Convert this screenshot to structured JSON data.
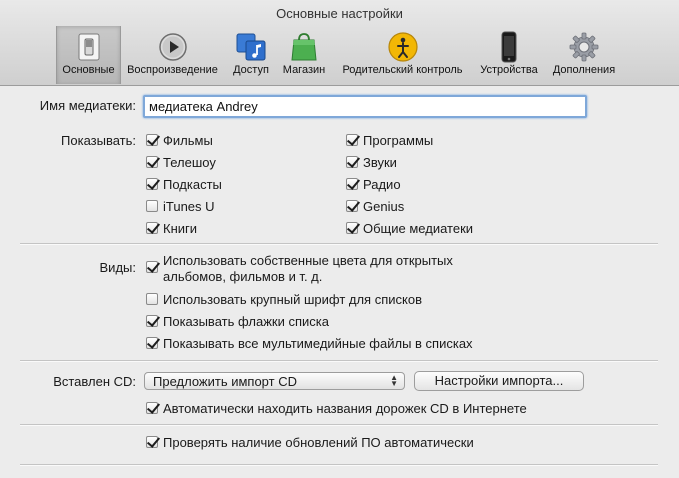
{
  "window": {
    "title": "Основные настройки"
  },
  "toolbar": {
    "tabs": [
      {
        "label": "Основные",
        "icon": "switch-icon"
      },
      {
        "label": "Воспроизведение",
        "icon": "play-icon"
      },
      {
        "label": "Доступ",
        "icon": "music-share-icon"
      },
      {
        "label": "Магазин",
        "icon": "store-bag-icon"
      },
      {
        "label": "Родительский контроль",
        "icon": "parental-control-icon"
      },
      {
        "label": "Устройства",
        "icon": "iphone-icon"
      },
      {
        "label": "Дополнения",
        "icon": "gear-icon"
      }
    ]
  },
  "library": {
    "label": "Имя медиатеки:",
    "value": "медиатека Andrey"
  },
  "show": {
    "label": "Показывать:",
    "left": [
      {
        "label": "Фильмы",
        "checked": true
      },
      {
        "label": "Телешоу",
        "checked": true
      },
      {
        "label": "Подкасты",
        "checked": true
      },
      {
        "label": "iTunes U",
        "checked": false
      },
      {
        "label": "Книги",
        "checked": true
      }
    ],
    "right": [
      {
        "label": "Программы",
        "checked": true
      },
      {
        "label": "Звуки",
        "checked": true
      },
      {
        "label": "Радио",
        "checked": true
      },
      {
        "label": "Genius",
        "checked": true
      },
      {
        "label": "Общие медиатеки",
        "checked": true
      }
    ]
  },
  "views": {
    "label": "Виды:",
    "items": [
      {
        "line1": "Использовать собственные цвета для открытых",
        "line2": "альбомов, фильмов и т. д.",
        "checked": true
      },
      {
        "line1": "Использовать крупный шрифт для списков",
        "checked": false
      },
      {
        "line1": "Показывать флажки списка",
        "checked": true
      },
      {
        "line1": "Показывать все мультимедийные файлы в списках",
        "checked": true
      }
    ]
  },
  "cd": {
    "label": "Вставлен CD:",
    "popup_value": "Предложить импорт CD",
    "import_button": "Настройки импорта...",
    "auto_lookup": {
      "label": "Автоматически находить названия дорожек CD в Интернете",
      "checked": true
    }
  },
  "updates": {
    "label": "Проверять наличие обновлений ПО автоматически",
    "checked": true
  }
}
